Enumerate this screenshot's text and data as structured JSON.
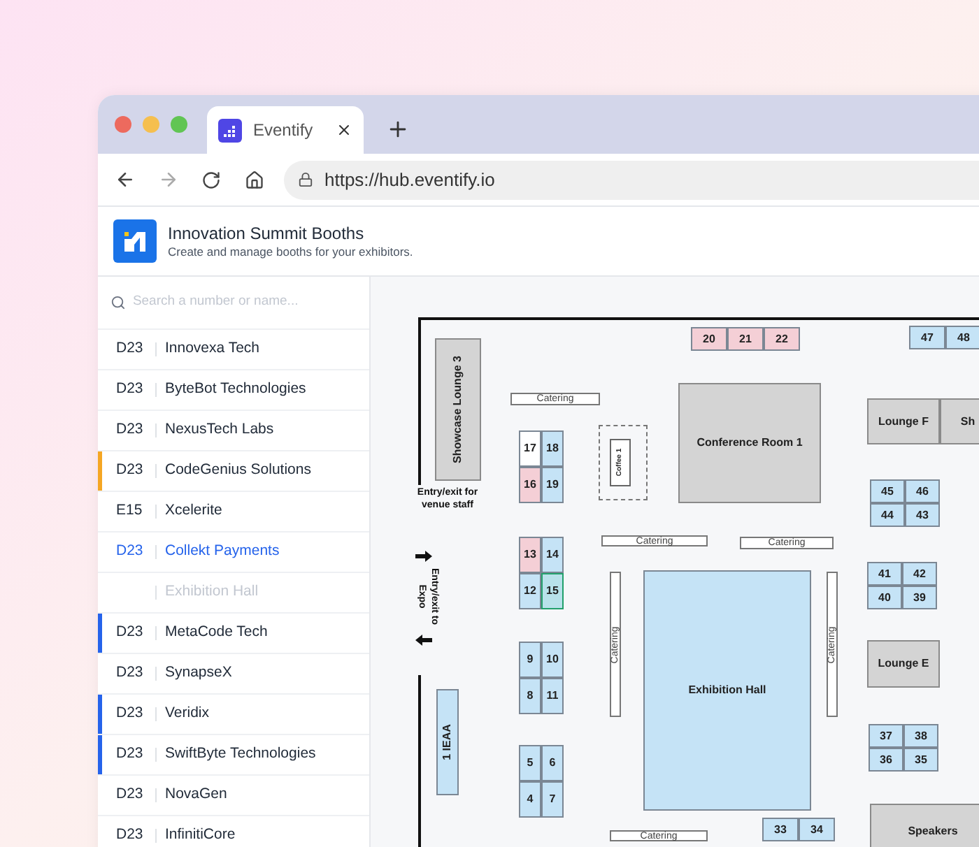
{
  "browser": {
    "tab_title": "Eventify",
    "url": "https://hub.eventify.io"
  },
  "header": {
    "title": "Innovation Summit Booths",
    "subtitle": "Create and manage booths for your exhibitors."
  },
  "sidebar": {
    "search": {
      "placeholder": "Search a number or name..."
    },
    "items": [
      {
        "kind": "booth",
        "code": "D23",
        "name": "Innovexa Tech",
        "selected": false
      },
      {
        "kind": "booth",
        "code": "D23",
        "name": "ByteBot Technologies",
        "selected": false
      },
      {
        "kind": "booth",
        "code": "D23",
        "name": "NexusTech Labs",
        "selected": false
      },
      {
        "kind": "booth",
        "code": "D23",
        "name": "CodeGenius Solutions",
        "selected": false,
        "color": "#f5a623"
      },
      {
        "kind": "booth",
        "code": "E15",
        "name": "Xcelerite",
        "selected": false
      },
      {
        "kind": "booth",
        "code": "D23",
        "name": "Collekt Payments",
        "selected": true
      },
      {
        "kind": "hall",
        "name": "Exhibition Hall",
        "selected": false
      },
      {
        "kind": "booth",
        "code": "D23",
        "name": "MetaCode Tech",
        "selected": false,
        "color": "#2563eb"
      },
      {
        "kind": "booth",
        "code": "D23",
        "name": "SynapseX",
        "selected": false
      },
      {
        "kind": "booth",
        "code": "D23",
        "name": "Veridix",
        "selected": false,
        "color": "#2563eb"
      },
      {
        "kind": "booth",
        "code": "D23",
        "name": "SwiftByte Technologies",
        "selected": false,
        "color": "#2563eb"
      },
      {
        "kind": "booth",
        "code": "D23",
        "name": "NovaGen",
        "selected": false
      },
      {
        "kind": "booth",
        "code": "D23",
        "name": "InfinitiCore",
        "selected": false
      }
    ]
  },
  "map": {
    "elements": [
      {
        "kind": "booth",
        "label": "20",
        "color": "#f4cfd6",
        "selected": false
      },
      {
        "kind": "booth",
        "label": "21",
        "color": "#f4cfd6",
        "selected": false
      },
      {
        "kind": "booth",
        "label": "22",
        "color": "#f4cfd6",
        "selected": false
      },
      {
        "kind": "booth",
        "label": "47",
        "color": "#c5e3f6",
        "selected": false
      },
      {
        "kind": "booth",
        "label": "48",
        "color": "#c5e3f6",
        "selected": false
      },
      {
        "kind": "room",
        "label": "Showcase Lounge 3"
      },
      {
        "kind": "catering",
        "label": "Catering"
      },
      {
        "kind": "room",
        "label": "Conference Room 1"
      },
      {
        "kind": "room",
        "label": "Lounge F"
      },
      {
        "kind": "room",
        "label": "Sh"
      },
      {
        "kind": "booth",
        "label": "17",
        "color": "#ffffff",
        "selected": false
      },
      {
        "kind": "booth",
        "label": "18",
        "color": "#c5e3f6",
        "selected": false
      },
      {
        "kind": "booth",
        "label": "16",
        "color": "#f4cfd6",
        "selected": false
      },
      {
        "kind": "booth",
        "label": "19",
        "color": "#c5e3f6",
        "selected": false
      },
      {
        "kind": "coffee",
        "label": "Coffee 1"
      },
      {
        "kind": "note",
        "label": "Entry/exit for venue staff"
      },
      {
        "kind": "booth",
        "label": "45",
        "color": "#c5e3f6",
        "selected": false
      },
      {
        "kind": "booth",
        "label": "46",
        "color": "#c5e3f6",
        "selected": false
      },
      {
        "kind": "booth",
        "label": "44",
        "color": "#c5e3f6",
        "selected": false
      },
      {
        "kind": "booth",
        "label": "43",
        "color": "#c5e3f6",
        "selected": false
      },
      {
        "kind": "catering",
        "label": "Catering"
      },
      {
        "kind": "catering",
        "label": "Catering"
      },
      {
        "kind": "booth",
        "label": "13",
        "color": "#f4cfd6",
        "selected": false
      },
      {
        "kind": "booth",
        "label": "14",
        "color": "#c5e3f6",
        "selected": false
      },
      {
        "kind": "booth",
        "label": "12",
        "color": "#c5e3f6",
        "selected": false
      },
      {
        "kind": "booth",
        "label": "15",
        "color": "#b8e2ea",
        "selected": true
      },
      {
        "kind": "note",
        "label": "Entry/exit to Expo"
      },
      {
        "kind": "booth",
        "label": "41",
        "color": "#c5e3f6",
        "selected": false
      },
      {
        "kind": "booth",
        "label": "42",
        "color": "#c5e3f6",
        "selected": false
      },
      {
        "kind": "booth",
        "label": "40",
        "color": "#c5e3f6",
        "selected": false
      },
      {
        "kind": "booth",
        "label": "39",
        "color": "#c5e3f6",
        "selected": false
      },
      {
        "kind": "catering",
        "label": "Catering"
      },
      {
        "kind": "hall",
        "label": "Exhibition Hall"
      },
      {
        "kind": "catering",
        "label": "Catering"
      },
      {
        "kind": "room",
        "label": "Lounge E"
      },
      {
        "kind": "booth",
        "label": "9",
        "color": "#c5e3f6",
        "selected": false
      },
      {
        "kind": "booth",
        "label": "10",
        "color": "#c5e3f6",
        "selected": false
      },
      {
        "kind": "booth",
        "label": "8",
        "color": "#c5e3f6",
        "selected": false
      },
      {
        "kind": "booth",
        "label": "11",
        "color": "#c5e3f6",
        "selected": false
      },
      {
        "kind": "hall",
        "label": "1 IEAA"
      },
      {
        "kind": "booth",
        "label": "5",
        "color": "#c5e3f6",
        "selected": false
      },
      {
        "kind": "booth",
        "label": "6",
        "color": "#c5e3f6",
        "selected": false
      },
      {
        "kind": "booth",
        "label": "4",
        "color": "#c5e3f6",
        "selected": false
      },
      {
        "kind": "booth",
        "label": "7",
        "color": "#c5e3f6",
        "selected": false
      },
      {
        "kind": "booth",
        "label": "37",
        "color": "#c5e3f6",
        "selected": false
      },
      {
        "kind": "booth",
        "label": "38",
        "color": "#c5e3f6",
        "selected": false
      },
      {
        "kind": "booth",
        "label": "36",
        "color": "#c5e3f6",
        "selected": false
      },
      {
        "kind": "booth",
        "label": "35",
        "color": "#c5e3f6",
        "selected": false
      },
      {
        "kind": "booth",
        "label": "33",
        "color": "#c5e3f6",
        "selected": false
      },
      {
        "kind": "booth",
        "label": "34",
        "color": "#c5e3f6",
        "selected": false
      },
      {
        "kind": "catering",
        "label": "Catering"
      },
      {
        "kind": "room",
        "label": "Speakers"
      }
    ]
  }
}
